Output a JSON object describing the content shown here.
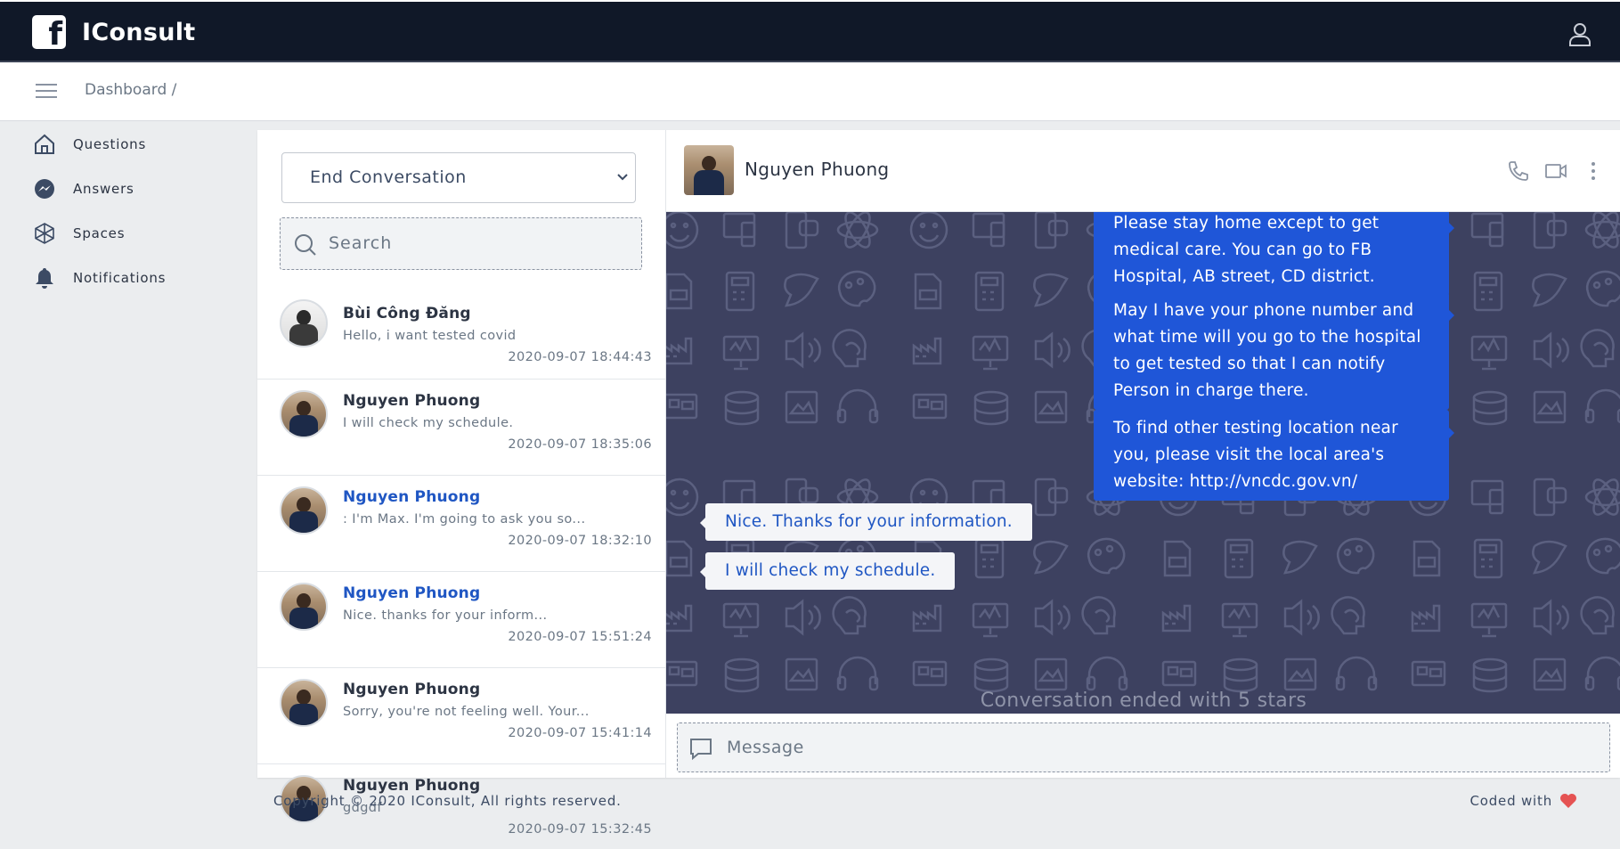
{
  "app": {
    "title": "IConsult",
    "logo_letter": "f"
  },
  "subheader": {
    "breadcrumb": "Dashboard /"
  },
  "sidebar": {
    "items": [
      {
        "label": "Questions",
        "icon": "home-icon"
      },
      {
        "label": "Answers",
        "icon": "messenger-icon"
      },
      {
        "label": "Spaces",
        "icon": "spaces-icon"
      },
      {
        "label": "Notifications",
        "icon": "bell-icon"
      }
    ]
  },
  "conversation_list": {
    "select_value": "End Conversation",
    "search_placeholder": "Search",
    "items": [
      {
        "name": "Bùi Công Đăng",
        "preview": "Hello, i want tested covid",
        "time": "2020-09-07 18:44:43",
        "unread": false
      },
      {
        "name": "Nguyen Phuong",
        "preview": "I will check my schedule.",
        "time": "2020-09-07 18:35:06",
        "unread": false
      },
      {
        "name": "Nguyen Phuong",
        "preview": ": I'm Max. I'm going to ask you so...",
        "time": "2020-09-07 18:32:10",
        "unread": true
      },
      {
        "name": "Nguyen Phuong",
        "preview": "Nice. thanks for your inform...",
        "time": "2020-09-07 15:51:24",
        "unread": true
      },
      {
        "name": "Nguyen Phuong",
        "preview": "Sorry, you're not feeling well. Your...",
        "time": "2020-09-07 15:41:14",
        "unread": false
      },
      {
        "name": "Nguyen Phuong",
        "preview": "gdgdf",
        "time": "2020-09-07 15:32:45",
        "unread": false
      }
    ]
  },
  "chat": {
    "contact_name": "Nguyen Phuong",
    "messages": [
      {
        "direction": "out",
        "text": "Please stay home except to get medical care. You can go to FB Hospital, AB street, CD district."
      },
      {
        "direction": "out",
        "text": "May I have your phone number and what time will you go to the hospital to get tested so that I can notify Person in charge there."
      },
      {
        "direction": "out",
        "text": "To find other testing location near you, please visit the local area's website: http://vncdc.gov.vn/"
      },
      {
        "direction": "in",
        "text": "Nice. Thanks for your information."
      },
      {
        "direction": "in",
        "text": "I will check my schedule."
      }
    ],
    "ended_note": "Conversation ended with 5 stars",
    "message_placeholder": "Message"
  },
  "footer": {
    "copyright": "Copyright © 2020 IConsult, All rights reserved.",
    "coded_with": "Coded with"
  },
  "colors": {
    "topbar": "#101828",
    "accent_blue": "#1f56d8",
    "chat_background": "#3d4160",
    "heart": "#e55353"
  }
}
